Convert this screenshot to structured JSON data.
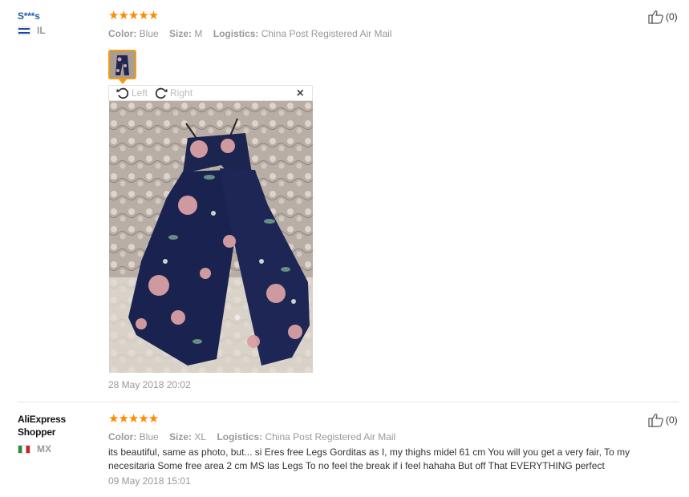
{
  "reviews": [
    {
      "user": "S***s",
      "country": "IL",
      "rating_stars": "★★★★★",
      "rating": 5,
      "color_label": "Color:",
      "color": "Blue",
      "size_label": "Size:",
      "size": "M",
      "logistics_label": "Logistics:",
      "logistics": "China Post Registered Air Mail",
      "viewer": {
        "left_label": "Left",
        "right_label": "Right",
        "close": "×"
      },
      "date": "28 May 2018 20:02",
      "helpful": "(0)"
    },
    {
      "user": "AliExpress Shopper",
      "country": "MX",
      "rating_stars": "★★★★★",
      "rating": 5,
      "color_label": "Color:",
      "color": "Blue",
      "size_label": "Size:",
      "size": "XL",
      "logistics_label": "Logistics:",
      "logistics": "China Post Registered Air Mail",
      "text": "its beautiful, same as photo, but... si Eres free Legs Gorditas as I, my thighs midel 61 cm You will you get a very fair, To my necesitaria Some free area 2 cm MS las Legs To no feel the break if i feel hahaha But off That EVERYTHING perfect",
      "date": "09 May 2018 15:01",
      "helpful": "(0)"
    }
  ],
  "colors": {
    "star": "#ff8a00",
    "username_link": "#1f5fa8",
    "thumb_border": "#f39c12",
    "muted": "#999999"
  },
  "icons": {
    "star": "star-icon",
    "thumbs_up": "thumbs-up-icon",
    "rotate_left": "rotate-left-icon",
    "rotate_right": "rotate-right-icon",
    "close": "close-icon"
  }
}
